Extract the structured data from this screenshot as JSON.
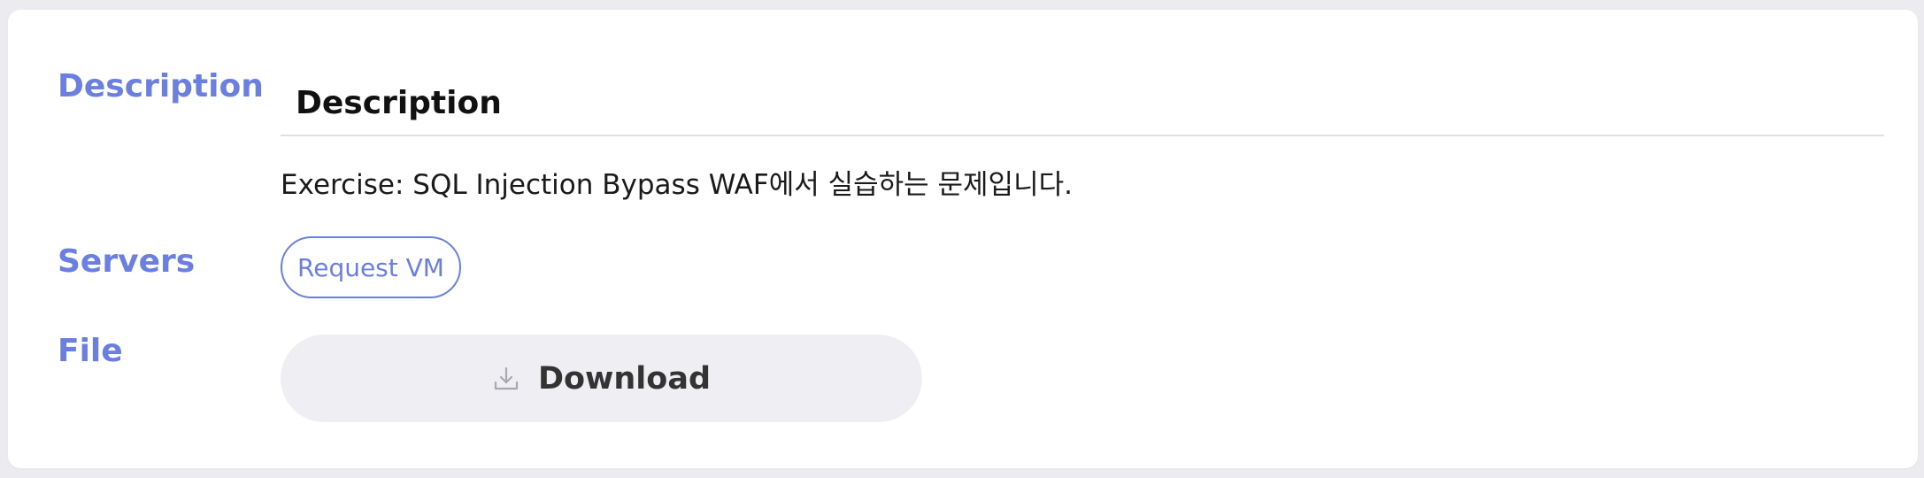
{
  "sections": {
    "description_label": "Description",
    "servers_label": "Servers",
    "file_label": "File"
  },
  "description": {
    "heading": "Description",
    "body": "Exercise: SQL Injection Bypass WAF에서 실습하는 문제입니다."
  },
  "servers": {
    "request_vm_label": "Request VM"
  },
  "file": {
    "download_label": "Download",
    "download_icon": "download-icon"
  },
  "colors": {
    "accent": "#6b7fe0",
    "page_bg": "#ebebf0",
    "card_bg": "#ffffff",
    "button_bg": "#efeff3"
  }
}
